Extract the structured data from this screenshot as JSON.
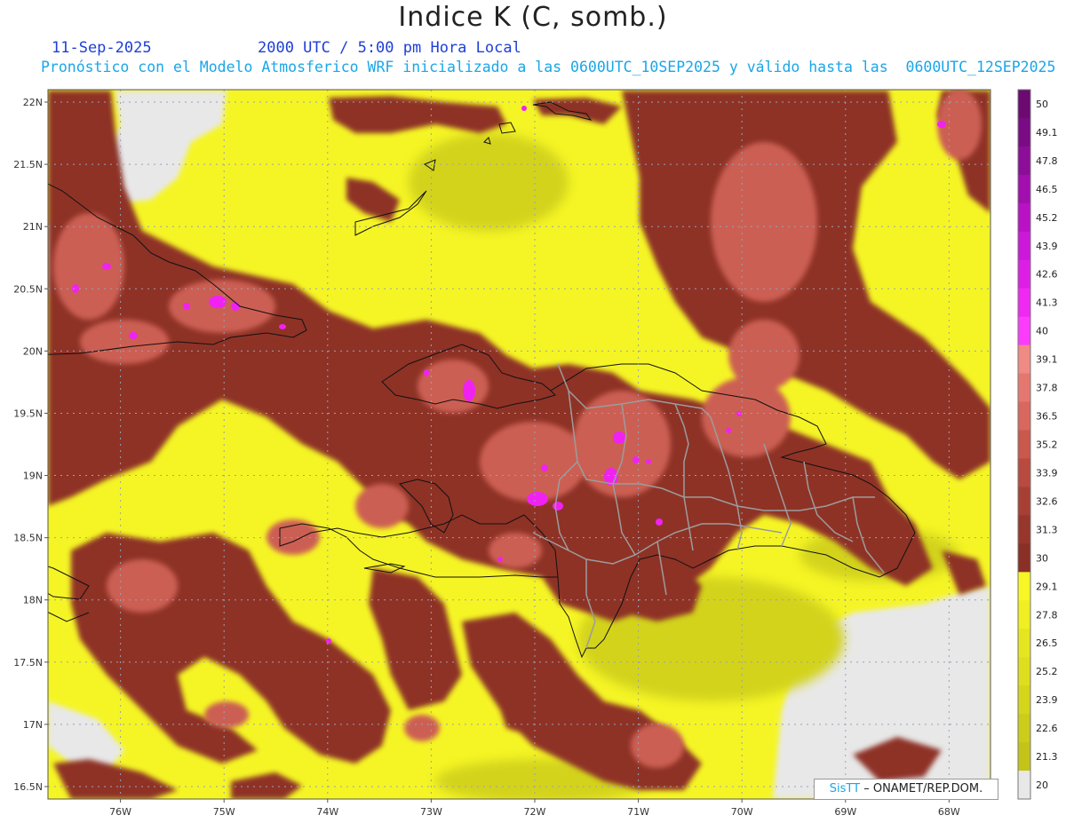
{
  "header": {
    "title": "Indice K (C, somb.)",
    "date": "11-Sep-2025",
    "time": "2000 UTC / 5:00 pm Hora Local",
    "run_info": "Pronóstico con el Modelo Atmosferico WRF inicializado a las 0600UTC_10SEP2025 y válido hasta las  0600UTC_12SEP2025"
  },
  "map": {
    "lat_ticks": [
      "22N",
      "21.5N",
      "21N",
      "20.5N",
      "20N",
      "19.5N",
      "19N",
      "18.5N",
      "18N",
      "17.5N",
      "17N",
      "16.5N"
    ],
    "lon_ticks": [
      "76W",
      "75W",
      "74W",
      "73W",
      "72W",
      "71W",
      "70W",
      "69W",
      "68W"
    ],
    "lat_range": [
      16.4,
      22.1
    ],
    "lon_range": [
      -76.7,
      -67.6
    ]
  },
  "colorbar": {
    "labels": [
      "50",
      "49.1",
      "47.8",
      "46.5",
      "45.2",
      "43.9",
      "42.6",
      "41.3",
      "40",
      "39.1",
      "37.8",
      "36.5",
      "35.2",
      "33.9",
      "32.6",
      "31.3",
      "30",
      "29.1",
      "27.8",
      "26.5",
      "25.2",
      "23.9",
      "22.6",
      "21.3",
      "20"
    ],
    "colors": [
      "#6c0a72",
      "#7a0b84",
      "#8c0d97",
      "#a20fae",
      "#b812c4",
      "#cc18d8",
      "#dd1fe6",
      "#ef28f2",
      "#fb3cfb",
      "#f08a84",
      "#e47870",
      "#d8675e",
      "#c9584d",
      "#b94a3f",
      "#a83f35",
      "#97362c",
      "#8a3026",
      "#f7f725",
      "#efef22",
      "#e6e620",
      "#dede1e",
      "#d5d51c",
      "#cccc1a",
      "#c4c418",
      "#e8e8e8"
    ]
  },
  "credit": {
    "brand": "SisTT",
    "text": "– ONAMET/REP.DOM."
  }
}
